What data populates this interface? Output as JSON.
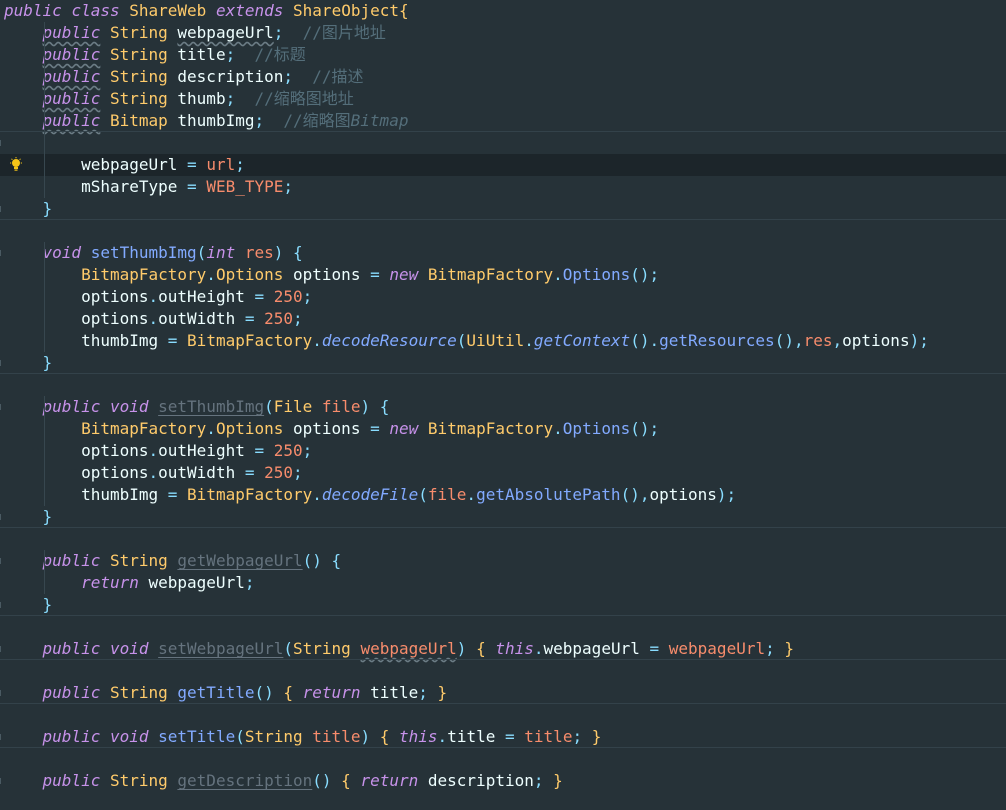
{
  "editor": {
    "theme_colors": {
      "background": "#263238",
      "keyword": "#c792ea",
      "type": "#ffcb6b",
      "function": "#82aaff",
      "comment": "#546e7a",
      "parameter": "#f78c6c",
      "number": "#f78c6c",
      "operator": "#89ddff",
      "text": "#eeffff"
    },
    "gutter_icon": "lightbulb-icon",
    "t": {
      "public": "public",
      "class": "class",
      "extends": "extends",
      "void": "void",
      "new": "new",
      "int": "int",
      "return": "return",
      "this": "this",
      "String": "String",
      "Bitmap": "Bitmap",
      "File": "File",
      "ShareWeb": "ShareWeb",
      "ShareObject": "ShareObject",
      "webpageUrl": "webpageUrl",
      "title": "title",
      "description": "description",
      "thumb": "thumb",
      "thumbImg": "thumbImg",
      "url": "url",
      "mShareType": "mShareType",
      "WEB_TYPE": "WEB_TYPE",
      "setThumbImg": "setThumbImg",
      "res": "res",
      "BitmapFactory": "BitmapFactory",
      "Options": "Options",
      "options": "options",
      "outHeight": "outHeight",
      "outWidth": "outWidth",
      "n250": "250",
      "decodeResource": "decodeResource",
      "UiUtil": "UiUtil",
      "getContext": "getContext",
      "getResources": "getResources",
      "file": "file",
      "decodeFile": "decodeFile",
      "getAbsolutePath": "getAbsolutePath",
      "getWebpageUrl": "getWebpageUrl",
      "setWebpageUrl": "setWebpageUrl",
      "getTitle": "getTitle",
      "setTitle": "setTitle",
      "getDescription": "getDescription",
      "c_webpageUrl": "//图片地址",
      "c_title": "//标题",
      "c_description": "//描述",
      "c_thumb": "//缩略图地址",
      "c_thumbImg_a": "//缩略图",
      "c_thumbImg_b": "Bitmap"
    }
  }
}
